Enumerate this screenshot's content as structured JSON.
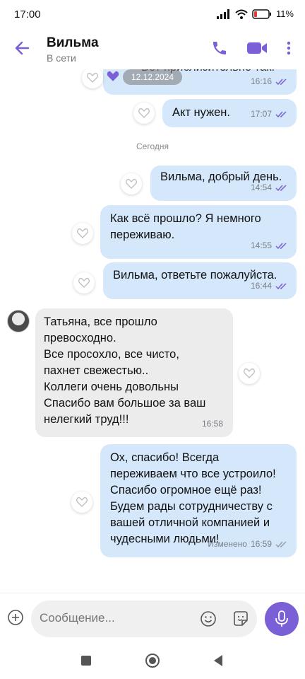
{
  "status_bar": {
    "time": "17:00",
    "battery": "11%"
  },
  "header": {
    "name": "Вильма",
    "status": "В сети"
  },
  "chat": {
    "date_pill": "12.12.2024",
    "top_partial_text": "Вот приблизительно так.",
    "date_separator": "Сегодня",
    "messages": [
      {
        "text": "Акт нужен.",
        "time": "17:07"
      },
      {
        "text": "Вильма, добрый день.",
        "time": "14:54"
      },
      {
        "text": "Как всё прошло? Я немного\nпереживаю.",
        "time": "14:55"
      },
      {
        "text": "Вильма, ответьте пожалуйста.",
        "time": "16:44"
      },
      {
        "text": "Татьяна, все прошло\nпревосходно.\nВсе просохло, все чисто,\nпахнет свежестью..\nКоллеги очень довольны\nСпасибо вам большое за ваш\nнелегкий труд!!!",
        "time": "16:58"
      },
      {
        "text": "Ох, спасибо! Всегда\nпереживаем что все устроило!\nСпасибо огромное ещё раз!\nБудем рады сотрудничеству с\nвашей отличной компанией и\nчудесными людьми!",
        "time": "16:59",
        "edited": "Изменено"
      }
    ],
    "top_time": "16:16"
  },
  "input": {
    "placeholder": "Сообщение..."
  },
  "icons": {
    "back": "arrow-left-icon",
    "call": "phone-icon",
    "video": "video-camera-icon",
    "more": "more-vertical-icon",
    "attach": "plus-circle-icon",
    "emoji": "smiley-icon",
    "sticker": "sticker-icon",
    "mic": "microphone-icon",
    "heart": "heart-icon",
    "read": "double-check-icon"
  },
  "colors": {
    "accent": "#7b5fd6",
    "outgoing_bubble": "#d4e7fb",
    "incoming_bubble": "#ececec",
    "read_check": "#7b5fd6"
  }
}
